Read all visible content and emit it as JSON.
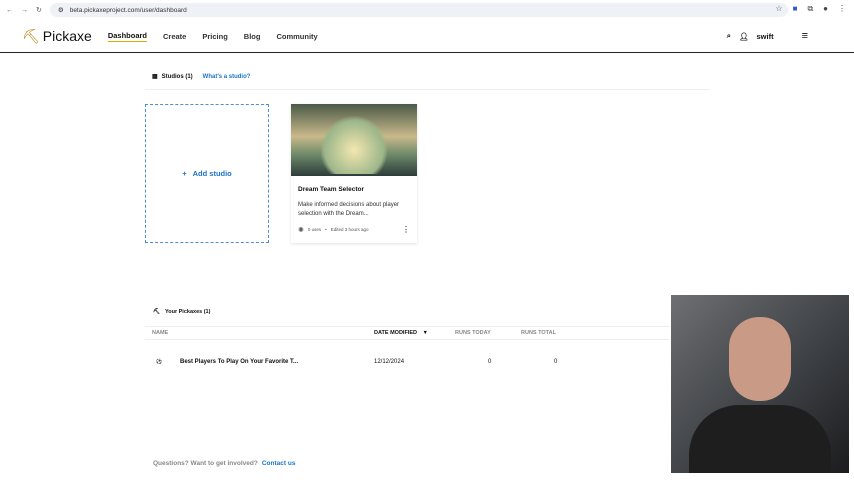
{
  "browser": {
    "url": "beta.pickaxeproject.com/user/dashboard"
  },
  "nav": {
    "logo": "Pickaxe",
    "items": [
      "Dashboard",
      "Create",
      "Pricing",
      "Blog",
      "Community"
    ],
    "user": "swift"
  },
  "studios": {
    "title": "Studios (1)",
    "help_link": "What's a studio?",
    "add_label": "Add studio",
    "cards": [
      {
        "title": "Dream Team Selector",
        "description": "Make informed decisions about player selection with the Dream...",
        "uses": "0 uses",
        "edited": "Edited 3 hours ago"
      }
    ]
  },
  "pickaxes": {
    "title": "Your Pickaxes (1)",
    "columns": [
      "NAME",
      "DATE MODIFIED",
      "RUNS TODAY",
      "RUNS TOTAL"
    ],
    "rows": [
      {
        "name": "Best Players To Play On Your Favorite T...",
        "date": "12/12/2024",
        "runs_today": "0",
        "runs_total": "0"
      }
    ]
  },
  "footer": {
    "question": "Questions? Want to get involved?",
    "contact": "Contact us"
  }
}
